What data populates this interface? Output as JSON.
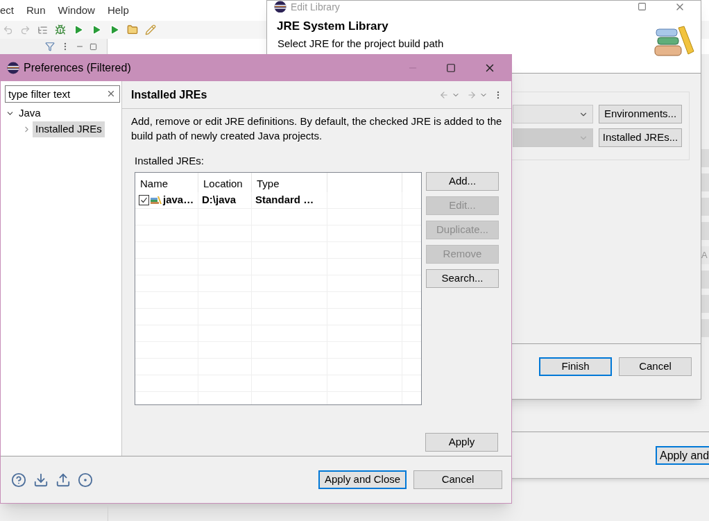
{
  "ide": {
    "menu": [
      "ect",
      "Run",
      "Window",
      "Help"
    ],
    "side_bars": [
      {
        "disabled": false
      },
      {
        "disabled": false
      },
      {
        "disabled": false
      },
      {
        "disabled": false
      },
      {
        "label": "A",
        "disabled": true
      },
      {
        "disabled": false
      },
      {
        "disabled": false
      },
      {
        "disabled": false
      }
    ],
    "apply_button": "Apply and"
  },
  "edit_library": {
    "title": "Edit Library",
    "heading": "JRE System Library",
    "message": "Select JRE for the project build path",
    "combos": [
      {
        "disabled": false,
        "button": "Environments..."
      },
      {
        "disabled": true,
        "button": "Installed JREs..."
      }
    ],
    "finish": "Finish",
    "cancel": "Cancel"
  },
  "preferences": {
    "title": "Preferences (Filtered)",
    "filter": {
      "placeholder": "type filter text"
    },
    "tree": [
      {
        "label": "Java",
        "expanded": true,
        "selected": false,
        "children": [
          {
            "label": "Installed JREs",
            "expanded": false,
            "selected": true
          }
        ]
      }
    ],
    "page_title": "Installed JREs",
    "description": "Add, remove or edit JRE definitions. By default, the checked JRE is added to the build path of newly created Java projects.",
    "table_label": "Installed JREs:",
    "columns": [
      "Name",
      "Location",
      "Type"
    ],
    "rows": [
      {
        "checked": true,
        "cells": [
          "java…",
          "D:\\java",
          "Standard …"
        ]
      }
    ],
    "side_buttons": [
      {
        "label": "Add...",
        "disabled": false
      },
      {
        "label": "Edit...",
        "disabled": true
      },
      {
        "label": "Duplicate...",
        "disabled": true
      },
      {
        "label": "Remove",
        "disabled": true
      },
      {
        "label": "Search...",
        "disabled": false
      }
    ],
    "apply": "Apply",
    "apply_close": "Apply and Close",
    "cancel": "Cancel"
  }
}
